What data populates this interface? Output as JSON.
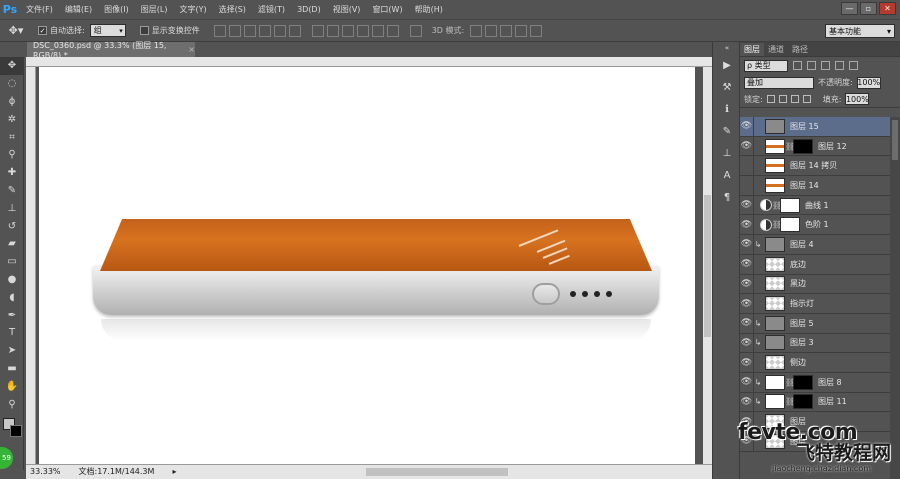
{
  "app": {
    "logo": "Ps"
  },
  "menu": [
    "文件(F)",
    "编辑(E)",
    "图像(I)",
    "图层(L)",
    "文字(Y)",
    "选择(S)",
    "滤镜(T)",
    "3D(D)",
    "视图(V)",
    "窗口(W)",
    "帮助(H)"
  ],
  "window_controls": [
    "—",
    "▫",
    "✕"
  ],
  "options": {
    "auto_select_label": "自动选择:",
    "auto_select_value": "组",
    "show_transform_label": "显示变换控件",
    "mode_3d_label": "3D 模式:",
    "workspace": "基本功能"
  },
  "document": {
    "tab_title": "DSC_0360.psd @ 33.3% (图层 15, RGB/8) *",
    "zoom": "33.33%",
    "doc_size": "文档:17.1M/144.3M"
  },
  "layers_panel": {
    "tabs": [
      "图层",
      "通道",
      "路径"
    ],
    "kind_filter": "ρ 类型",
    "blend_mode": "叠加",
    "opacity_label": "不透明度:",
    "opacity_value": "100%",
    "lock_label": "锁定:",
    "fill_label": "填充:",
    "fill_value": "100%",
    "layers": [
      {
        "name": "图层 15",
        "visible": true,
        "thumb": "gray",
        "selected": true
      },
      {
        "name": "图层 12",
        "visible": true,
        "thumb": "orange",
        "mask": "black"
      },
      {
        "name": "图层 14 拷贝",
        "visible": false,
        "thumb": "orange"
      },
      {
        "name": "图层 14",
        "visible": false,
        "thumb": "orange"
      },
      {
        "name": "曲线 1",
        "visible": true,
        "adjustment": true,
        "mask": "white"
      },
      {
        "name": "色阶 1",
        "visible": true,
        "adjustment": true,
        "mask": "white"
      },
      {
        "name": "图层 4",
        "visible": true,
        "thumb": "gray",
        "clipped": true
      },
      {
        "name": "底边",
        "visible": true,
        "thumb": "checker"
      },
      {
        "name": "黑边",
        "visible": true,
        "thumb": "checker"
      },
      {
        "name": "指示灯",
        "visible": true,
        "thumb": "checker"
      },
      {
        "name": "图层 5",
        "visible": true,
        "thumb": "gray",
        "clipped": true
      },
      {
        "name": "图层 3",
        "visible": true,
        "thumb": "gray",
        "clipped": true
      },
      {
        "name": "侧边",
        "visible": true,
        "thumb": "checker"
      },
      {
        "name": "图层 8",
        "visible": true,
        "thumb": "white",
        "clipped": true,
        "mask": "black"
      },
      {
        "name": "图层 11",
        "visible": true,
        "thumb": "white",
        "clipped": true,
        "mask": "black"
      },
      {
        "name": "图层",
        "visible": true,
        "thumb": "checker"
      },
      {
        "name": "图层",
        "visible": true,
        "thumb": "checker"
      }
    ]
  },
  "watermark": {
    "line1": "fevte.com",
    "line2": "飞特教程网",
    "line3": "jiaocheng.chazidian.com"
  }
}
